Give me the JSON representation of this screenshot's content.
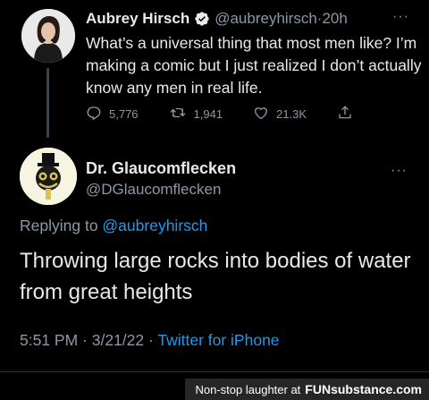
{
  "tweet1": {
    "name": "Aubrey Hirsch",
    "handle": "@aubreyhirsch",
    "separator": " · ",
    "time": "20h",
    "text": "What’s a universal thing that most men like? I’m making a comic but I just realized I don’t actually know any men in real life.",
    "replies": "5,776",
    "retweets": "1,941",
    "likes": "21.3K",
    "more": "···"
  },
  "tweet2": {
    "name": "Dr. Glaucomflecken",
    "handle": "@DGlaucomflecken",
    "replying_prefix": "Replying to ",
    "replying_to": "@aubreyhirsch",
    "text": "Throwing large rocks into bodies of water from great heights",
    "time": "5:51 PM · 3/21/22 · ",
    "source": "Twitter for iPhone",
    "more": "···"
  },
  "watermark": {
    "caption": "Non-stop laughter at",
    "brand": "FUNsubstance.com"
  },
  "colors": {
    "background": "#000000",
    "text": "#e7e9ea",
    "secondary": "#8b98a5",
    "accent": "#1d9bf0"
  },
  "icons": [
    "verified-badge-icon",
    "reply-icon",
    "retweet-icon",
    "like-icon",
    "share-icon",
    "more-icon"
  ]
}
